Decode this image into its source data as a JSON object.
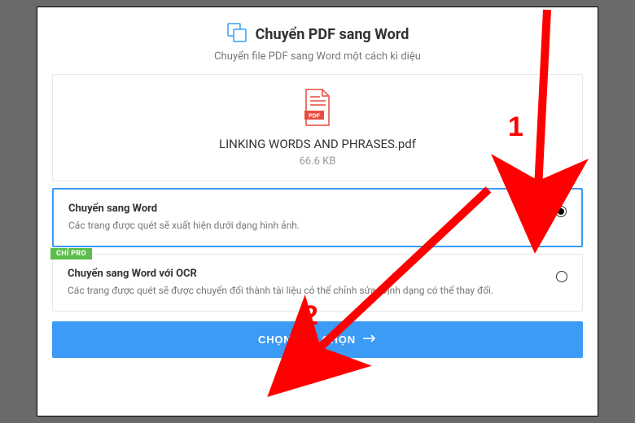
{
  "header": {
    "title": "Chuyển PDF sang Word",
    "subtitle": "Chuyển file PDF sang Word một cách kì diệu"
  },
  "file": {
    "name": "LINKING WORDS AND PHRASES.pdf",
    "size": "66.6 KB",
    "icon_badge": "PDF"
  },
  "options": {
    "opt1": {
      "title": "Chuyển sang Word",
      "desc": "Các trang được quét sẽ xuất hiện dưới dạng hình ảnh.",
      "selected": true
    },
    "opt2": {
      "title": "Chuyển sang Word với OCR",
      "desc": "Các trang được quét sẽ được chuyển đổi thành tài liệu có thể chỉnh sửa. Định dạng có thể thay đổi.",
      "selected": false,
      "badge": "CHỈ PRO"
    }
  },
  "cta": {
    "label": "CHỌN TÙY CHỌN"
  },
  "annotations": {
    "one": "1",
    "two": "2"
  }
}
